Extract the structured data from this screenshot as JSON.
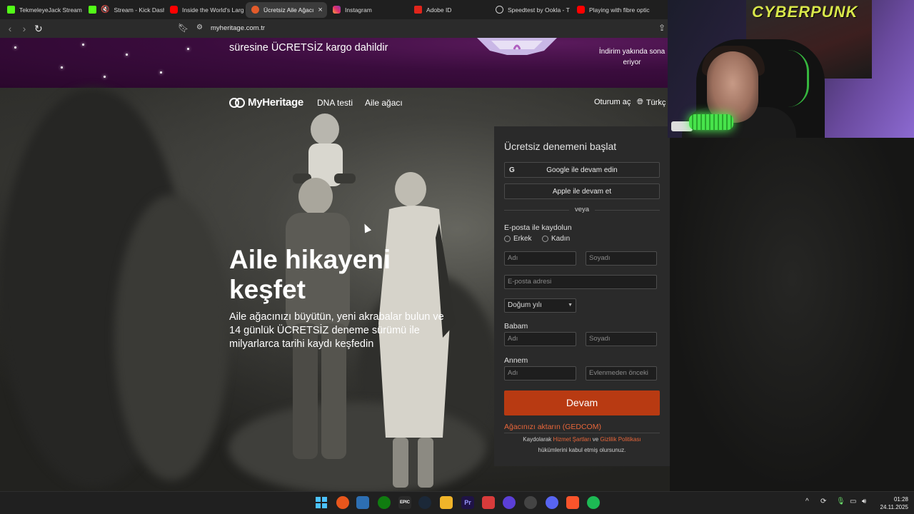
{
  "browser": {
    "tabs": [
      {
        "label": "TekmeleyeJack Stream",
        "icon": "kick-icon"
      },
      {
        "label": "Stream - Kick Dash",
        "icon": "kick-icon"
      },
      {
        "label": "Inside the World's Larg",
        "icon": "youtube-icon"
      },
      {
        "label": "Ücretsiz Aile Ağacı",
        "icon": "myheritage-icon"
      },
      {
        "label": "Instagram",
        "icon": "instagram-icon"
      },
      {
        "label": "Adobe ID",
        "icon": "adobe-icon"
      },
      {
        "label": "Speedtest by Ookla - T",
        "icon": "speedtest-icon"
      },
      {
        "label": "Playing with fibre optic",
        "icon": "youtube-icon"
      }
    ],
    "active_tab_close": "×",
    "url": "myheritage.com.tr"
  },
  "promo": {
    "text": "süresine ÜCRETSİZ kargo dahildir",
    "right_text": "İndirim yakında sona eriyor"
  },
  "nav": {
    "logo": "MyHeritage",
    "links": [
      "DNA testi",
      "Aile ağacı"
    ],
    "login": "Oturum aç",
    "language": "Türkç"
  },
  "hero": {
    "headline": "Aile hikayeni keşfet",
    "subline": "Aile ağacınızı büyütün, yeni akrabalar bulun ve 14 günlük ÜCRETSİZ deneme sürümü ile milyarlarca tarihi kaydı keşfedin"
  },
  "signup": {
    "title": "Ücretsiz denemeni başlat",
    "google_label": "Google ile devam edin",
    "apple_label": "Apple ile devam et",
    "or_text": "veya",
    "email_section": "E-posta ile kaydolun",
    "gender_male": "Erkek",
    "gender_female": "Kadın",
    "first_name_ph": "Adı",
    "last_name_ph": "Soyadı",
    "email_ph": "E-posta adresi",
    "birth_year": "Doğum yılı",
    "father_label": "Babam",
    "father_first_ph": "Adı",
    "father_last_ph": "Soyadı",
    "mother_label": "Annem",
    "mother_first_ph": "Adı",
    "mother_maiden_ph": "Evlenmeden önceki",
    "submit": "Devam",
    "import_link": "Ağacınızı aktarın (GEDCOM)",
    "terms_prefix": "Kaydolarak",
    "terms_link": "Hizmet Şartları",
    "terms_and": "ve",
    "privacy_link": "Gizlilik Politikası",
    "terms_suffix": "hükümlerini kabul etmiş olursunuz."
  },
  "webcam": {
    "poster_text": "CYBERPUNK"
  },
  "taskbar": {
    "time": "01:28",
    "date": "24.11.2025"
  },
  "colors": {
    "accent": "#b83a12",
    "link": "#e8663a",
    "promo_bg": "#3a0c3d",
    "panel_bg": "#2a2a2a"
  }
}
